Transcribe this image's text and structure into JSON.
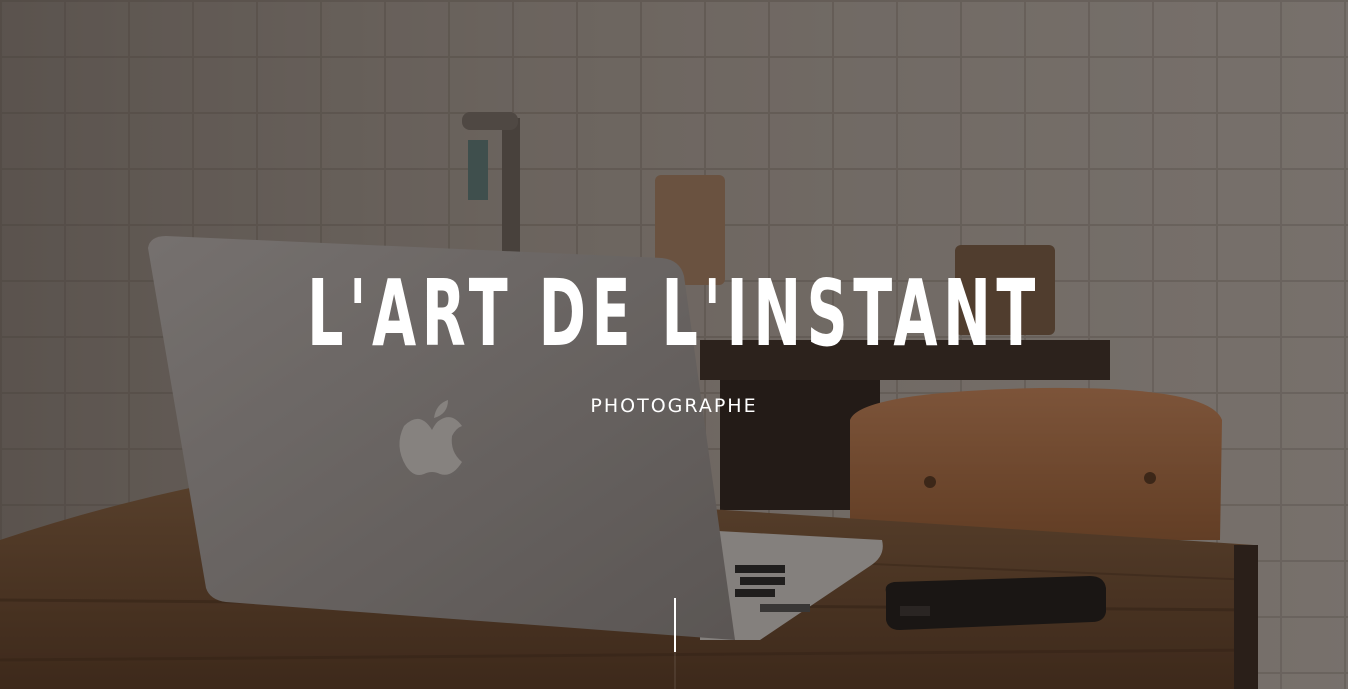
{
  "hero": {
    "title": "L'ART DE L'INSTANT",
    "subtitle": "PHOTOGRAPHE"
  },
  "colors": {
    "text": "#ffffff",
    "overlay": "#120e0c"
  }
}
